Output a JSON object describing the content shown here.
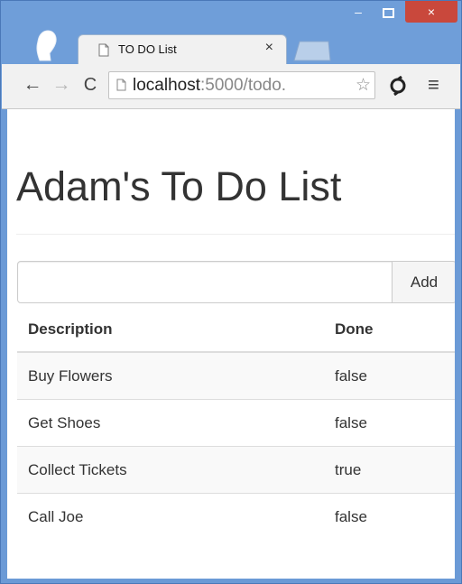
{
  "browser": {
    "tab": {
      "title": "TO DO List",
      "close_glyph": "×"
    },
    "window_controls": {
      "minimize": "–",
      "close": "×"
    },
    "toolbar": {
      "back_glyph": "←",
      "forward_glyph": "→",
      "reload_glyph": "C",
      "url_host": "localhost",
      "url_rest": ":5000/todo.",
      "star_glyph": "☆",
      "menu_glyph": "≡"
    }
  },
  "page": {
    "heading": "Adam's To Do List",
    "input": {
      "value": "",
      "placeholder": ""
    },
    "add_button_label": "Add",
    "table": {
      "columns": [
        "Description",
        "Done"
      ],
      "rows": [
        {
          "description": "Buy Flowers",
          "done": "false"
        },
        {
          "description": "Get Shoes",
          "done": "false"
        },
        {
          "description": "Collect Tickets",
          "done": "true"
        },
        {
          "description": "Call Joe",
          "done": "false"
        }
      ]
    }
  },
  "colors": {
    "window_frame": "#6b9ad6",
    "close_button": "#c9483c",
    "toolbar": "#f1f1f1",
    "text": "#333333"
  }
}
